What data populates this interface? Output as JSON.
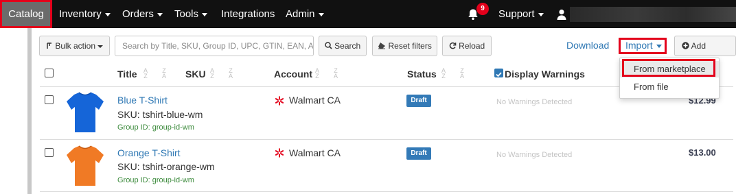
{
  "nav": {
    "catalog": "Catalog",
    "inventory": "Inventory",
    "orders": "Orders",
    "tools": "Tools",
    "integrations": "Integrations",
    "admin": "Admin",
    "notifications_count": "9",
    "support": "Support",
    "user_icon": "user-icon",
    "bell_icon": "bell-icon"
  },
  "toolbar": {
    "bulk_action": "Bulk action",
    "search_placeholder": "Search by Title, SKU, Group ID, UPC, GTIN, EAN, ASIN",
    "search_button": "Search",
    "reset_filters": "Reset filters",
    "reload": "Reload",
    "download": "Download",
    "import": "Import",
    "add_product": "Add product"
  },
  "import_menu": {
    "items": [
      "From marketplace",
      "From file"
    ]
  },
  "table": {
    "columns": {
      "title": "Title",
      "sku": "SKU",
      "account": "Account",
      "status": "Status",
      "display_warnings": "Display Warnings"
    },
    "rows": [
      {
        "title": "Blue T-Shirt",
        "sku": "SKU: tshirt-blue-wm",
        "group": "Group ID: group-id-wm",
        "account": "Walmart CA",
        "status": "Draft",
        "warnings": "No Warnings Detected",
        "price": "$12.99",
        "shirt_color": "#1565d8"
      },
      {
        "title": "Orange T-Shirt",
        "sku": "SKU: tshirt-orange-wm",
        "group": "Group ID: group-id-wm",
        "account": "Walmart CA",
        "status": "Draft",
        "warnings": "No Warnings Detected",
        "price": "$13.00",
        "shirt_color": "#f07a25"
      }
    ]
  },
  "colors": {
    "highlight": "#e3001b",
    "link": "#2f78b4",
    "nav_bg": "#111111",
    "status_blue": "#337ab7",
    "walmart_red": "#e3001b"
  }
}
